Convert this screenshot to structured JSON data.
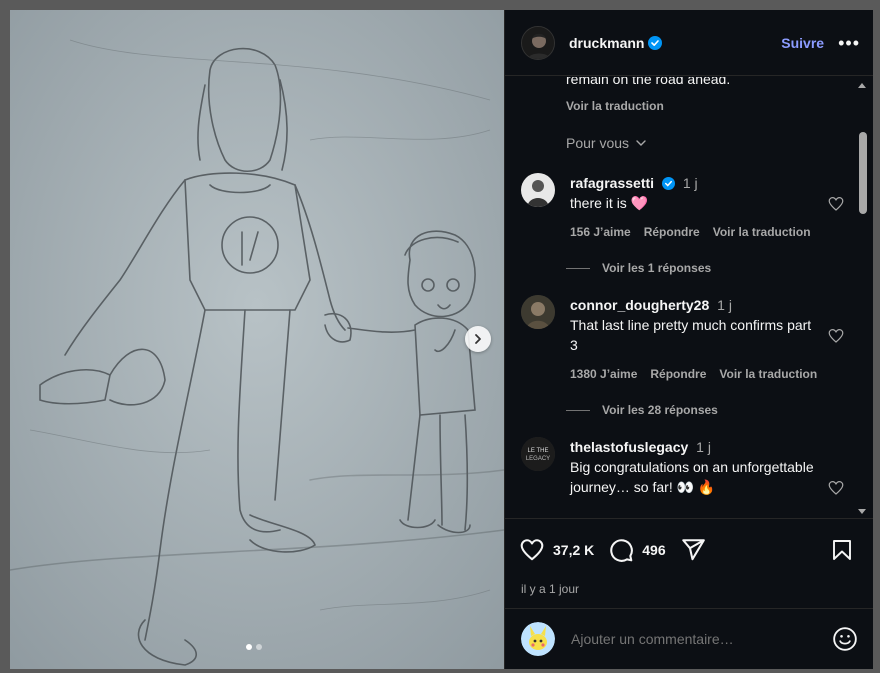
{
  "post": {
    "username": "druckmann",
    "follow_label": "Suivre",
    "more_label": "•••",
    "likes": "37,2 K",
    "comments_count": "496",
    "time_ago": "il y a 1 jour"
  },
  "caption": {
    "cut_text": "remain on the road ahead.",
    "see_translation": "Voir la traduction",
    "show_more": "Pour vous"
  },
  "comments": [
    {
      "user": "rafagrassetti",
      "time": "1 j",
      "text": "there it is 🩷",
      "likes": "156 J’aime",
      "reply": "Répondre",
      "translate": "Voir la traduction",
      "replies": "Voir les 1 réponses"
    },
    {
      "user": "connor_dougherty28",
      "time": "1 j",
      "text": "That last line pretty much confirms part 3",
      "likes": "1380 J’aime",
      "reply": "Répondre",
      "translate": "Voir la traduction",
      "replies": "Voir les 28 réponses"
    },
    {
      "user": "thelastofuslegacy",
      "time": "1 j",
      "text": "Big congratulations on an unforgettable journey… so far! 👀 🔥"
    }
  ],
  "add_comment": {
    "placeholder": "Ajouter un commentaire…"
  },
  "icons": {
    "verified": "verified-badge-icon",
    "like": "heart-icon",
    "comment": "comment-bubble-icon",
    "share": "paper-plane-icon",
    "save": "bookmark-icon",
    "emoji": "smiley-icon",
    "next": "chevron-right-icon"
  },
  "colors": {
    "accent": "#8c9cff",
    "verified": "#0095f6",
    "panel_bg": "#0c0f14"
  }
}
